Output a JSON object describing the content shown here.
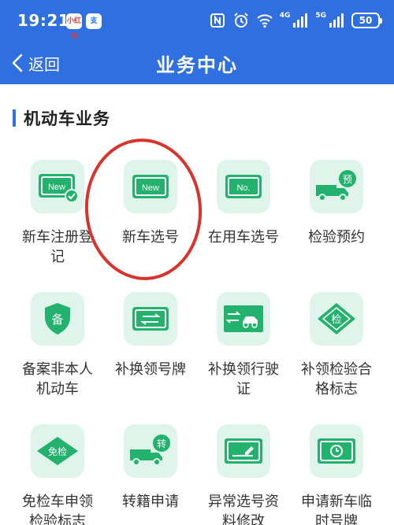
{
  "status_bar": {
    "time": "19:21",
    "app_badges": [
      "小红书",
      "支"
    ],
    "network_labels": [
      "4G",
      "5G"
    ],
    "battery": "50"
  },
  "nav": {
    "back_label": "返回",
    "title": "业务中心"
  },
  "section": {
    "title": "机动车业务"
  },
  "services": [
    {
      "label": "新车注册登记",
      "icon": "new-plate-check-icon",
      "icon_text": "New"
    },
    {
      "label": "新车选号",
      "icon": "new-plate-icon",
      "icon_text": "New"
    },
    {
      "label": "在用车选号",
      "icon": "plate-number-icon",
      "icon_text": "No."
    },
    {
      "label": "检验预约",
      "icon": "truck-reserve-icon",
      "icon_text": "预"
    },
    {
      "label": "备案非本人机动车",
      "icon": "shield-record-icon",
      "icon_text": "备"
    },
    {
      "label": "补换领号牌",
      "icon": "plate-exchange-icon",
      "icon_text": ""
    },
    {
      "label": "补换领行驶证",
      "icon": "license-exchange-icon",
      "icon_text": ""
    },
    {
      "label": "补领检验合格标志",
      "icon": "inspection-badge-icon",
      "icon_text": "检"
    },
    {
      "label": "免检车申领检验标志",
      "icon": "exempt-badge-icon",
      "icon_text": "免检"
    },
    {
      "label": "转籍申请",
      "icon": "truck-transfer-icon",
      "icon_text": "转"
    },
    {
      "label": "异常选号资料修改",
      "icon": "edit-plate-icon",
      "icon_text": ""
    },
    {
      "label": "申请新车临时号牌",
      "icon": "temp-plate-icon",
      "icon_text": ""
    }
  ],
  "colors": {
    "header": "#2f6fe0",
    "tile_bg": "#dff5ec",
    "icon_green": "#23b26d",
    "annotation": "#d9342b"
  }
}
